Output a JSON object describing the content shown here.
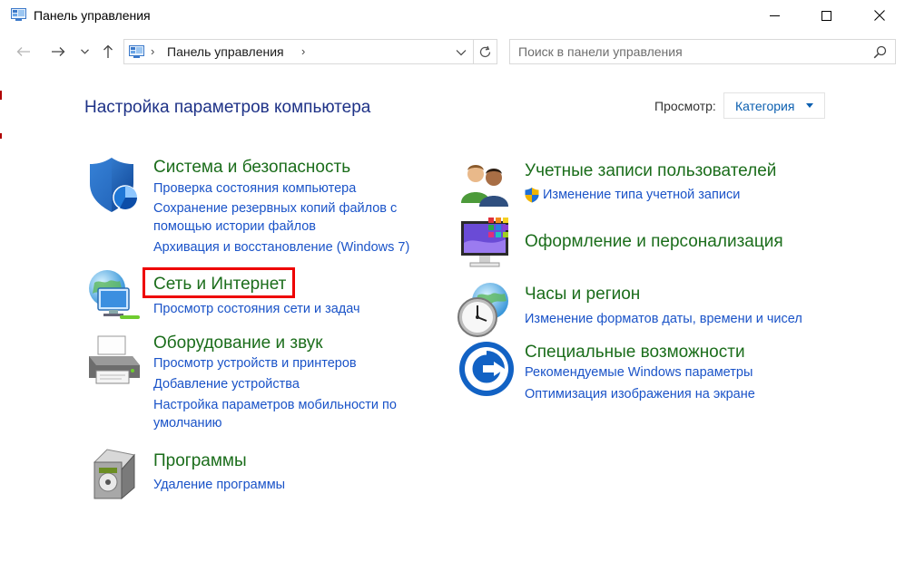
{
  "window": {
    "title": "Панель управления",
    "controls": {
      "minimize": "minimize",
      "maximize": "maximize",
      "close": "close"
    }
  },
  "nav": {
    "address": "Панель управления",
    "search_placeholder": "Поиск в панели управления"
  },
  "header": {
    "title": "Настройка параметров компьютера",
    "view_label": "Просмотр:",
    "view_value": "Категория"
  },
  "categories": {
    "system": {
      "title": "Система и безопасность",
      "links": [
        "Проверка состояния компьютера",
        "Сохранение резервных копий файлов с",
        "помощью истории файлов",
        "Архивация и восстановление (Windows 7)"
      ]
    },
    "network": {
      "title": "Сеть и Интернет",
      "links": [
        "Просмотр состояния сети и задач"
      ]
    },
    "hardware": {
      "title": "Оборудование и звук",
      "links": [
        "Просмотр устройств и принтеров",
        "Добавление устройства",
        "Настройка параметров мобильности по",
        "умолчанию"
      ]
    },
    "programs": {
      "title": "Программы",
      "links": [
        "Удаление программы"
      ]
    },
    "accounts": {
      "title": "Учетные записи пользователей",
      "links": [
        "Изменение типа учетной записи"
      ]
    },
    "appearance": {
      "title": "Оформление и персонализация",
      "links": []
    },
    "clock": {
      "title": "Часы и регион",
      "links": [
        "Изменение форматов даты, времени и чисел"
      ]
    },
    "access": {
      "title": "Специальные возможности",
      "links": [
        "Рекомендуемые Windows параметры",
        "Оптимизация изображения на экране"
      ]
    }
  },
  "colors": {
    "title_blue": "#1e3287",
    "category_green": "#1b6d1b",
    "link_blue": "#1a53c8",
    "highlight_red": "#ee0000"
  },
  "icons": {
    "system": "security-shield-icon",
    "network": "network-globe-icon",
    "hardware": "printer-icon",
    "programs": "programs-box-icon",
    "accounts": "users-icon",
    "appearance": "monitor-palette-icon",
    "clock": "clock-globe-icon",
    "access": "accessibility-icon"
  }
}
